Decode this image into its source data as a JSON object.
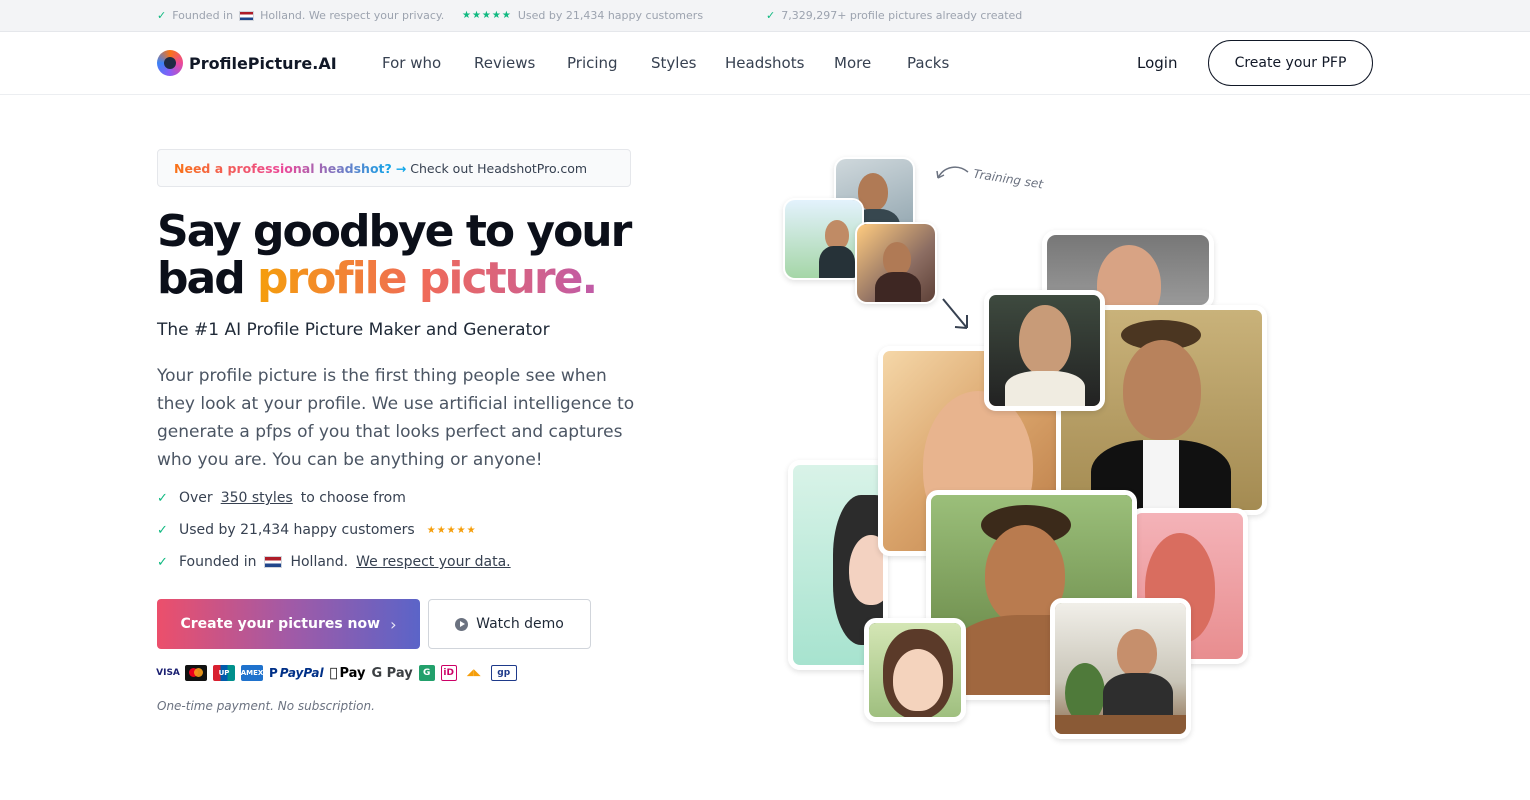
{
  "topbar": {
    "item1": "Founded in",
    "item1b": "Holland. We respect your privacy.",
    "item2": "Used by 21,434 happy customers",
    "item3": "7,329,297+ profile pictures already created",
    "stars": "★★★★★"
  },
  "nav": {
    "logo_text": "ProfilePicture.AI",
    "links": [
      "For who",
      "Reviews",
      "Pricing",
      "Styles",
      "Headshots",
      "More",
      "Packs"
    ],
    "login": "Login",
    "cta": "Create your PFP"
  },
  "hero": {
    "banner_strong": "Need a professional headshot?",
    "banner_arrow": "→",
    "banner_rest": "Check out HeadshotPro.com",
    "headline_line1": "Say goodbye to your",
    "headline_bad": "bad",
    "headline_grad": "profile picture.",
    "subhead": "The #1 AI Profile Picture Maker and Generator",
    "paragraph": "Your profile picture is the first thing people see when they look at your profile. We use artificial intelligence to generate a pfps of you that looks perfect and captures who you are. You can be anything or anyone!",
    "features": {
      "f1_pre": "Over",
      "f1_link": "350 styles",
      "f1_post": "to choose from",
      "f2": "Used by 21,434 happy customers",
      "f2_stars": "★★★★★",
      "f3_pre": "Founded in",
      "f3_mid": "Holland.",
      "f3_link": "We respect your data."
    },
    "cta_main": "Create your pictures now",
    "cta_chevron": "›",
    "cta_demo": "Watch demo",
    "payments": {
      "visa": "VISA",
      "union": "UP",
      "amex": "AMEX",
      "paypal": "PayPal",
      "apple": "Pay",
      "gpay": "G Pay",
      "green": "G",
      "ideal": "iD",
      "gp": "gp"
    },
    "fineprint": "One-time payment. No subscription."
  },
  "collage": {
    "annotation": "Training set"
  },
  "colors": {
    "accent_green": "#10b981",
    "gradient_start": "#ec4f6b",
    "gradient_end": "#5b64c8"
  }
}
